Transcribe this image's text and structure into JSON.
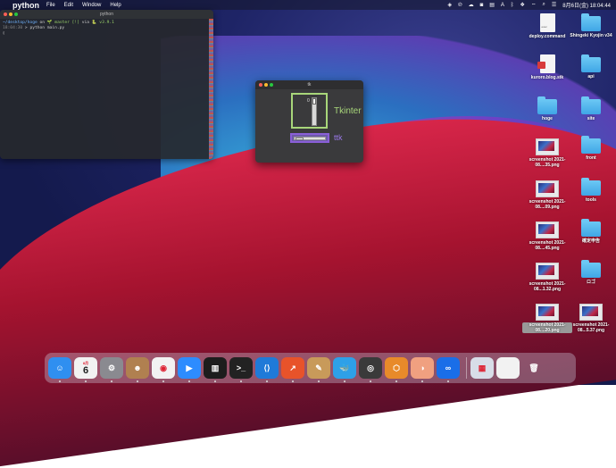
{
  "menubar": {
    "apple_icon": "apple-icon",
    "app_name": "python",
    "menus": [
      "File",
      "Edit",
      "Window",
      "Help"
    ],
    "status_icons": [
      "shield-icon",
      "fire-icon",
      "cloud-icon",
      "camera-icon",
      "scroll-icon",
      "a-icon",
      "bluetooth-icon",
      "dropbox-icon",
      "wifi-icon",
      "search-icon",
      "control-center-icon"
    ],
    "clock": "8月6日(金)  18:04:44"
  },
  "terminal": {
    "title": "python",
    "line1_path": "~/desktop/hoge",
    "line1_on": " on ",
    "line1_branch": "🌱 master [!]",
    "line1_via": " via ",
    "line1_version": "🐍 v3.9.1",
    "line2_time": "18:04:30",
    "line2_prompt": " > ",
    "line2_cmd": "python main.py",
    "cursor": "▯"
  },
  "tk_window": {
    "title": "tk",
    "scale_value": "0",
    "scale_level": 0.0,
    "tk_label": "Tkinter",
    "ttk_label": "ttk",
    "ttk_level": 0.0,
    "colors": {
      "tk_border": "#a8d67a",
      "ttk_border": "#8a5fd8"
    }
  },
  "desktop_icons": [
    {
      "label": "deploy.command",
      "kind": "doc",
      "tag": "exec"
    },
    {
      "label": "Shingeki Kyojin v34",
      "kind": "folder"
    },
    {
      "label": "kuroro.blog.stk",
      "kind": "doc-red"
    },
    {
      "label": "api",
      "kind": "folder"
    },
    {
      "label": "hoge",
      "kind": "folder"
    },
    {
      "label": "site",
      "kind": "folder"
    },
    {
      "label": "screenshot 2021-08....35.png",
      "kind": "shot"
    },
    {
      "label": "front",
      "kind": "folder"
    },
    {
      "label": "screenshot 2021-08....09.png",
      "kind": "shot"
    },
    {
      "label": "tools",
      "kind": "folder"
    },
    {
      "label": "screenshot 2021-08....45.png",
      "kind": "shot"
    },
    {
      "label": "確定申告",
      "kind": "folder"
    },
    {
      "label": "screenshot 2021-08...1.32.png",
      "kind": "shot"
    },
    {
      "label": "ロゴ",
      "kind": "folder"
    },
    {
      "label": "screenshot 2021-08....20.png",
      "kind": "shot"
    },
    {
      "label": "screenshot 2021-08...5.37.png",
      "kind": "shot"
    }
  ],
  "dock": {
    "apps": [
      {
        "name": "finder-icon",
        "glyph": "☺",
        "color": "#2f8ff0"
      },
      {
        "name": "calendar-icon",
        "glyph": "6",
        "color": "#f2f2f2"
      },
      {
        "name": "system-preferences-icon",
        "glyph": "⚙",
        "color": "#8a8a90"
      },
      {
        "name": "contacts-icon",
        "glyph": "☻",
        "color": "#b08050"
      },
      {
        "name": "chrome-icon",
        "glyph": "◉",
        "color": "#f2f2f2"
      },
      {
        "name": "zoom-icon",
        "glyph": "▶",
        "color": "#2d8cff"
      },
      {
        "name": "activity-monitor-icon",
        "glyph": "▥",
        "color": "#1d1d1d"
      },
      {
        "name": "terminal-icon",
        "glyph": ">_",
        "color": "#222"
      },
      {
        "name": "vscode-icon",
        "glyph": "⟨⟩",
        "color": "#1f7ad8"
      },
      {
        "name": "app-orange-icon",
        "glyph": "↗",
        "color": "#e8532a"
      },
      {
        "name": "archive-utility-icon",
        "glyph": "✎",
        "color": "#c89a5a"
      },
      {
        "name": "docker-icon",
        "glyph": "🐳",
        "color": "#2ea0e8"
      },
      {
        "name": "screen-recorder-icon",
        "glyph": "◎",
        "color": "#3a3a3a"
      },
      {
        "name": "sourcetree-icon",
        "glyph": "⬡",
        "color": "#e88a2a"
      },
      {
        "name": "app-peach-icon",
        "glyph": "◑",
        "color": "#f0a080"
      },
      {
        "name": "infinity-icon",
        "glyph": "∞",
        "color": "#1a6ee8"
      },
      {
        "name": "preview-icon",
        "glyph": "▦",
        "color": "#d8dde8"
      },
      {
        "name": "document-icon",
        "glyph": "",
        "color": "#f2f2f2"
      },
      {
        "name": "trash-icon",
        "glyph": "🗑",
        "color": "transparent"
      }
    ],
    "calendar_month": "8月"
  }
}
